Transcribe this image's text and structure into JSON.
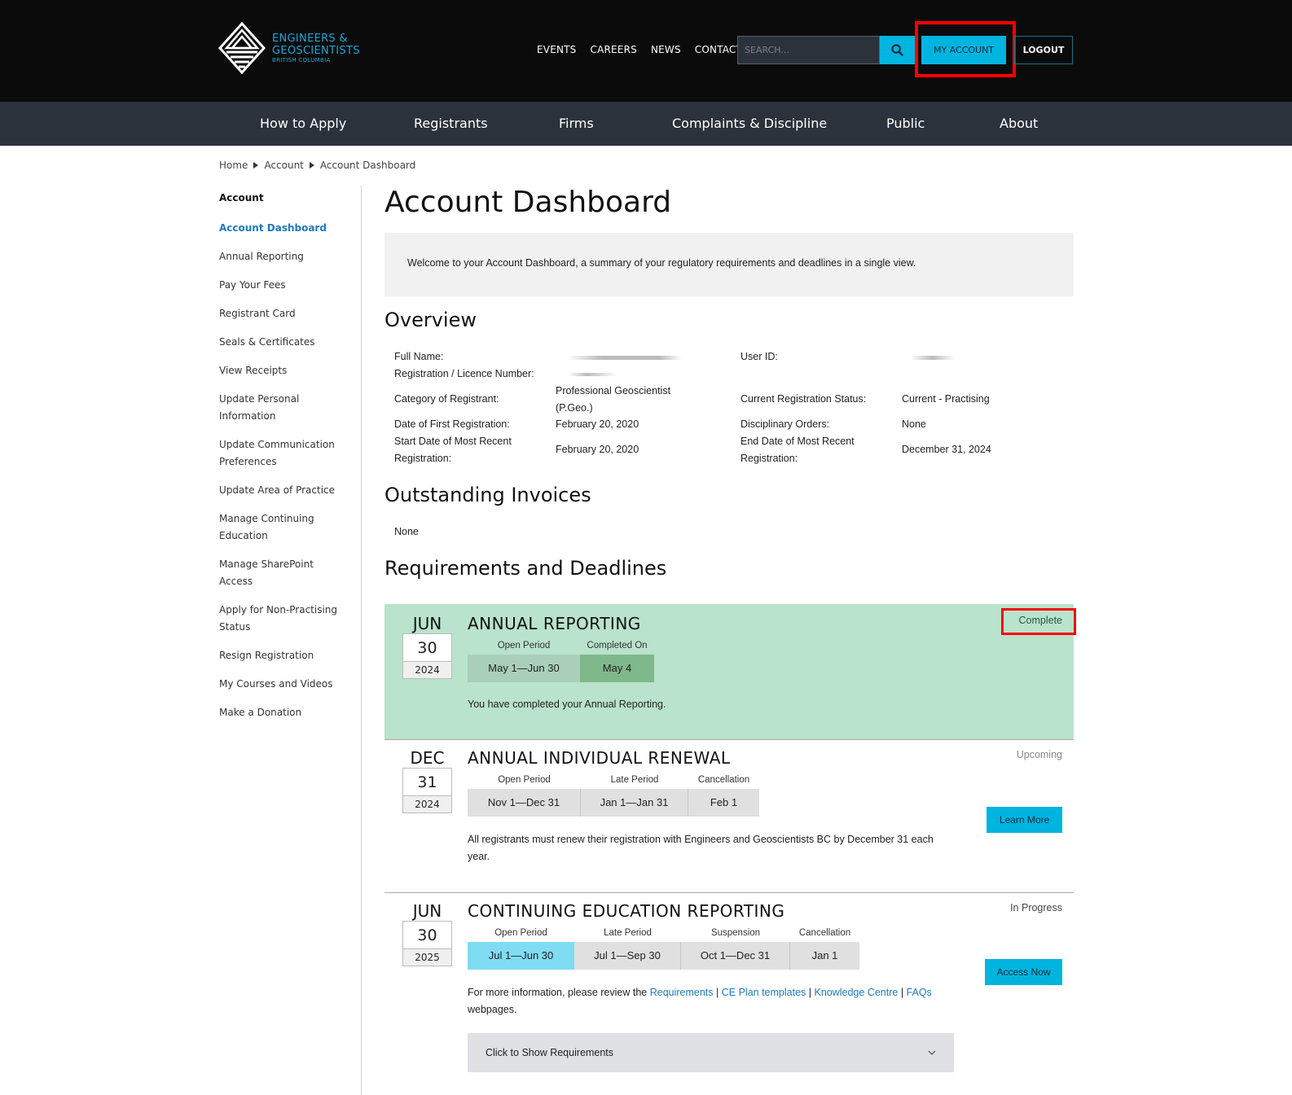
{
  "header": {
    "logo": {
      "line1": "ENGINEERS &",
      "line2": "GEOSCIENTISTS",
      "line3": "BRITISH COLUMBIA"
    },
    "util_nav": [
      "EVENTS",
      "CAREERS",
      "NEWS",
      "CONTACT"
    ],
    "search": {
      "placeholder": "SEARCH...",
      "value": ""
    },
    "my_account_label": "MY ACCOUNT",
    "logout_label": "LOGOUT"
  },
  "main_nav": [
    "How to Apply",
    "Registrants",
    "Firms",
    "Complaints & Discipline",
    "Public",
    "About"
  ],
  "breadcrumb": [
    "Home",
    "Account",
    "Account Dashboard"
  ],
  "sidebar": {
    "heading": "Account",
    "items": [
      {
        "label": "Account Dashboard",
        "active": true
      },
      {
        "label": "Annual Reporting"
      },
      {
        "label": "Pay Your Fees"
      },
      {
        "label": "Registrant Card"
      },
      {
        "label": "Seals & Certificates"
      },
      {
        "label": "View Receipts"
      },
      {
        "label": "Update Personal Information"
      },
      {
        "label": "Update Communication Preferences"
      },
      {
        "label": "Update Area of Practice"
      },
      {
        "label": "Manage Continuing Education"
      },
      {
        "label": "Manage SharePoint Access"
      },
      {
        "label": "Apply for Non-Practising Status"
      },
      {
        "label": "Resign Registration"
      },
      {
        "label": "My Courses and Videos"
      },
      {
        "label": "Make a Donation"
      }
    ]
  },
  "page": {
    "title": "Account Dashboard",
    "welcome": "Welcome to your Account Dashboard, a summary of your regulatory requirements and deadlines in a single view."
  },
  "overview": {
    "heading": "Overview",
    "full_name_label": "Full Name:",
    "reg_number_label": "Registration / Licence Number:",
    "category_label": "Category of Registrant:",
    "category_value_1": "Professional Geoscientist",
    "category_value_2": "(P.Geo.)",
    "first_reg_label": "Date of First Registration:",
    "first_reg_value": "February 20, 2020",
    "start_recent_label_1": "Start Date of Most Recent",
    "start_recent_label_2": "Registration:",
    "start_recent_value": "February 20, 2020",
    "user_id_label": "User ID:",
    "status_label": "Current Registration Status:",
    "status_value": "Current - Practising",
    "disciplinary_label": "Disciplinary Orders:",
    "disciplinary_value": "None",
    "end_recent_label_1": "End Date of Most Recent",
    "end_recent_label_2": "Registration:",
    "end_recent_value": "December 31, 2024"
  },
  "invoices": {
    "heading": "Outstanding Invoices",
    "value": "None"
  },
  "requirements": {
    "heading": "Requirements and Deadlines",
    "items": [
      {
        "month": "JUN",
        "day": "30",
        "year": "2024",
        "title": "ANNUAL REPORTING",
        "status": "Complete",
        "periods": [
          {
            "label": "Open Period",
            "value": "May 1—Jun 30"
          },
          {
            "label": "Completed On",
            "value": "May 4"
          }
        ],
        "description": "You have completed your Annual Reporting.",
        "colors": {
          "bg": "#b9e3cc",
          "open": "#a9cfba",
          "completed": "#7fb88a"
        }
      },
      {
        "month": "DEC",
        "day": "31",
        "year": "2024",
        "title": "ANNUAL INDIVIDUAL RENEWAL",
        "status": "Upcoming",
        "periods": [
          {
            "label": "Open Period",
            "value": "Nov 1—Dec 31"
          },
          {
            "label": "Late Period",
            "value": "Jan 1—Jan 31"
          },
          {
            "label": "Cancellation",
            "value": "Feb 1"
          }
        ],
        "description": "All registrants must renew their registration with Engineers and Geoscientists BC by December 31 each year.",
        "cta": "Learn More"
      },
      {
        "month": "JUN",
        "day": "30",
        "year": "2025",
        "title": "CONTINUING EDUCATION REPORTING",
        "status": "In Progress",
        "periods": [
          {
            "label": "Open Period",
            "value": "Jul 1—Jun 30"
          },
          {
            "label": "Late Period",
            "value": "Jul 1—Sep 30"
          },
          {
            "label": "Suspension",
            "value": "Oct 1—Dec 31"
          },
          {
            "label": "Cancellation",
            "value": "Jan 1"
          }
        ],
        "description_prefix": "For more information, please review the ",
        "links": [
          "Requirements",
          "CE Plan templates",
          "Knowledge Centre",
          "FAQs"
        ],
        "description_suffix": "webpages.",
        "cta": "Access Now",
        "accordion": "Click to Show Requirements",
        "colors": {
          "active": "#7fdcf2"
        }
      }
    ]
  },
  "colors": {
    "accent": "#00b4e0",
    "link": "#1c7ac0",
    "header_bg": "#0b0b0b",
    "nav_bg": "#2b323c",
    "annotation_red": "#ff0000"
  }
}
